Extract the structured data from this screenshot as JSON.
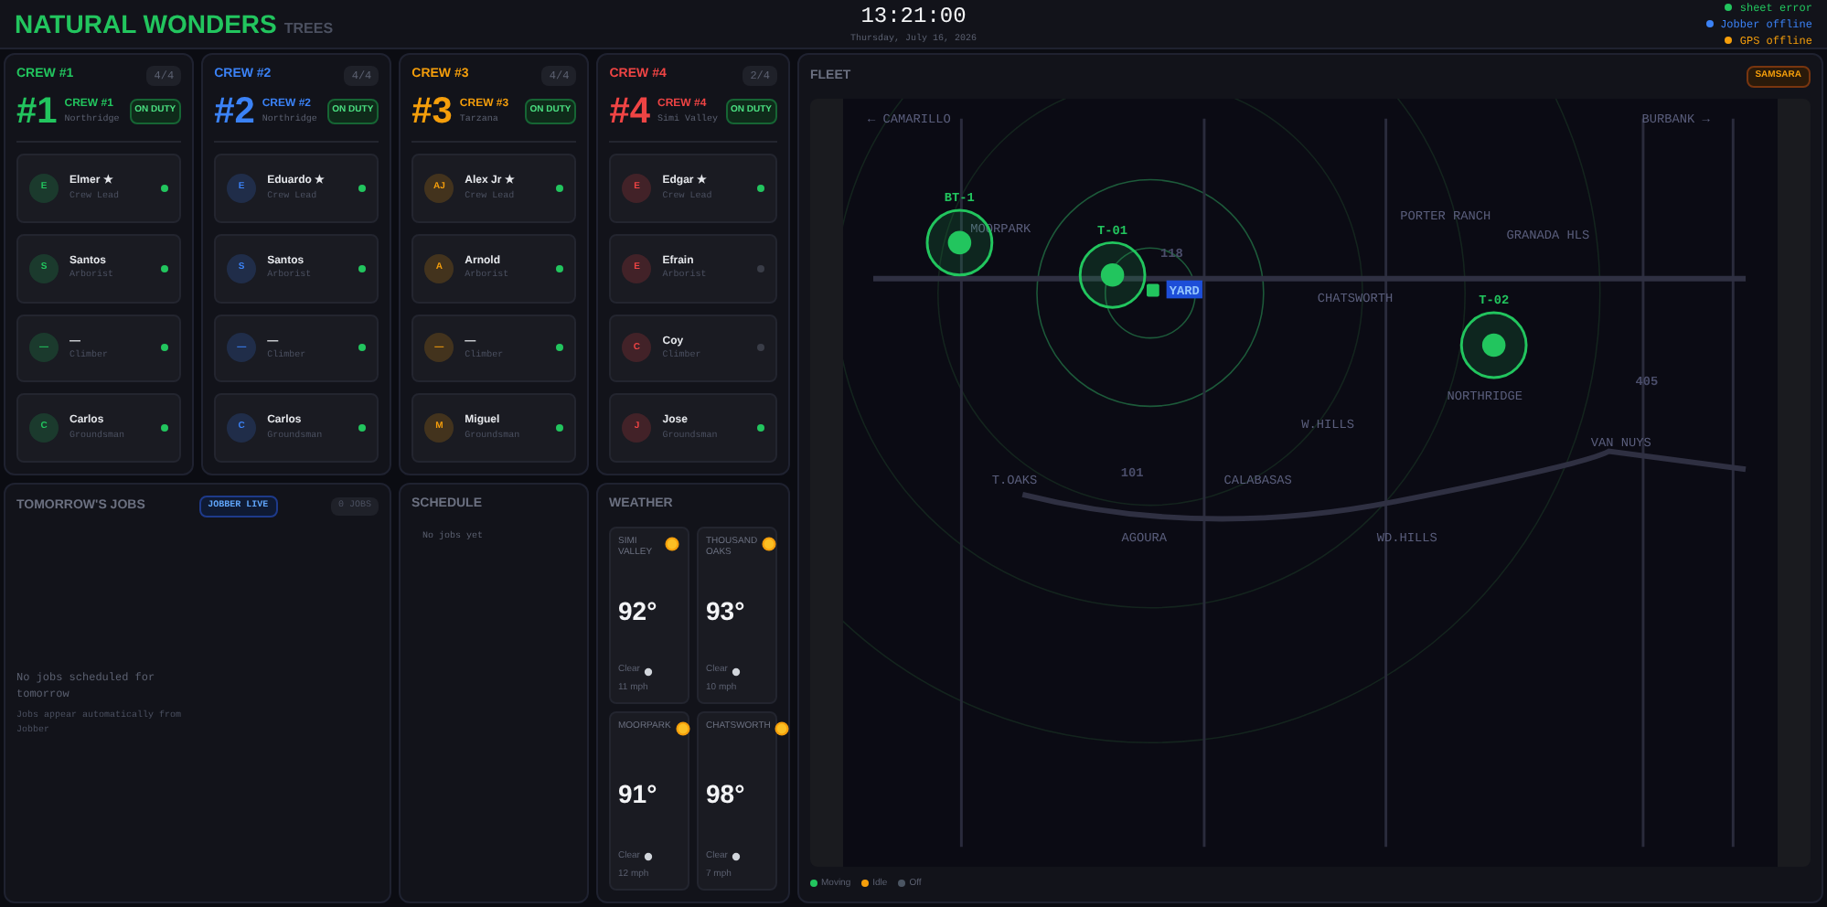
{
  "header": {
    "brand": "NATURAL WONDERS",
    "sub": "TREES",
    "time": "13:21:00",
    "date": "Thursday, July 16, 2026",
    "statuses": [
      {
        "label": "sheet error",
        "color": "#22c55e"
      },
      {
        "label": "Jobber offline",
        "color": "#3b82f6"
      },
      {
        "label": "GPS offline",
        "color": "#f59e0b"
      }
    ]
  },
  "crews": [
    {
      "tag": "CREW #1",
      "count": "4/4",
      "number": "#1",
      "name": "CREW #1",
      "area": "Northridge",
      "status": "ON DUTY",
      "color": "#22c55e",
      "members": [
        {
          "initial": "E",
          "name": "Elmer ★",
          "role": "Crew Lead",
          "online": true
        },
        {
          "initial": "S",
          "name": "Santos",
          "role": "Arborist",
          "online": true
        },
        {
          "initial": "—",
          "name": "—",
          "role": "Climber",
          "online": true
        },
        {
          "initial": "C",
          "name": "Carlos",
          "role": "Groundsman",
          "online": true
        }
      ]
    },
    {
      "tag": "CREW #2",
      "count": "4/4",
      "number": "#2",
      "name": "CREW #2",
      "area": "Northridge",
      "status": "ON DUTY",
      "color": "#3b82f6",
      "members": [
        {
          "initial": "E",
          "name": "Eduardo ★",
          "role": "Crew Lead",
          "online": true
        },
        {
          "initial": "S",
          "name": "Santos",
          "role": "Arborist",
          "online": true
        },
        {
          "initial": "—",
          "name": "—",
          "role": "Climber",
          "online": true
        },
        {
          "initial": "C",
          "name": "Carlos",
          "role": "Groundsman",
          "online": true
        }
      ]
    },
    {
      "tag": "CREW #3",
      "count": "4/4",
      "number": "#3",
      "name": "CREW #3",
      "area": "Tarzana",
      "status": "ON DUTY",
      "color": "#f59e0b",
      "members": [
        {
          "initial": "AJ",
          "name": "Alex Jr ★",
          "role": "Crew Lead",
          "online": true
        },
        {
          "initial": "A",
          "name": "Arnold",
          "role": "Arborist",
          "online": true
        },
        {
          "initial": "—",
          "name": "—",
          "role": "Climber",
          "online": true
        },
        {
          "initial": "M",
          "name": "Miguel",
          "role": "Groundsman",
          "online": true
        }
      ]
    },
    {
      "tag": "CREW #4",
      "count": "2/4",
      "number": "#4",
      "name": "CREW #4",
      "area": "Simi Valley",
      "status": "ON DUTY",
      "color": "#ef4444",
      "members": [
        {
          "initial": "E",
          "name": "Edgar ★",
          "role": "Crew Lead",
          "online": true
        },
        {
          "initial": "E",
          "name": "Efrain",
          "role": "Arborist",
          "online": false
        },
        {
          "initial": "C",
          "name": "Coy",
          "role": "Climber",
          "online": false
        },
        {
          "initial": "J",
          "name": "Jose",
          "role": "Groundsman",
          "online": true
        }
      ]
    }
  ],
  "jobs": {
    "title": "TOMORROW'S JOBS",
    "source": "JOBBER LIVE",
    "count": "0 JOBS",
    "empty_title": "No jobs scheduled for tomorrow",
    "empty_hint": "Jobs appear automatically from Jobber"
  },
  "schedule": {
    "title": "SCHEDULE",
    "empty": "No jobs yet"
  },
  "weather": {
    "title": "WEATHER",
    "cities": [
      {
        "name": "SIMI VALLEY",
        "temp": "92°",
        "condition": "Clear",
        "wind": "11 mph"
      },
      {
        "name": "THOUSAND OAKS",
        "temp": "93°",
        "condition": "Clear",
        "wind": "10 mph"
      },
      {
        "name": "MOORPARK",
        "temp": "91°",
        "condition": "Clear",
        "wind": "12 mph"
      },
      {
        "name": "CHATSWORTH",
        "temp": "98°",
        "condition": "Clear",
        "wind": "7 mph"
      }
    ]
  },
  "fleet": {
    "title": "FLEET",
    "provider": "SAMSARA",
    "places": [
      "← CAMARILLO",
      "BURBANK →",
      "MOORPARK",
      "PORTER RANCH",
      "GRANADA HLS",
      "CHATSWORTH",
      "NORTHRIDGE",
      "W.HILLS",
      "VAN NUYS",
      "T.OAKS",
      "CALABASAS",
      "WD.HILLS",
      "AGOURA"
    ],
    "highways": [
      "118",
      "101",
      "405"
    ],
    "yard": "YARD",
    "vehicles": [
      {
        "id": "BT-1",
        "color": "#22c55e"
      },
      {
        "id": "T-01",
        "color": "#22c55e"
      },
      {
        "id": "T-02",
        "color": "#22c55e"
      }
    ],
    "legend": [
      {
        "label": "Moving",
        "color": "#22c55e"
      },
      {
        "label": "Idle",
        "color": "#f59e0b"
      },
      {
        "label": "Off",
        "color": "#4b5563"
      }
    ]
  }
}
